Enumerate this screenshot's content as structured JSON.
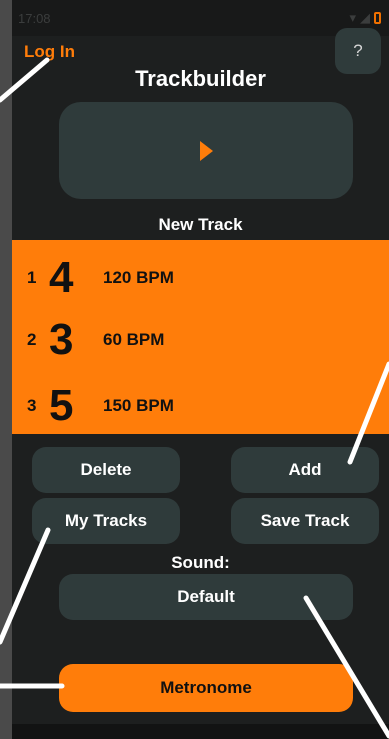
{
  "status_bar": {
    "time": "17:08",
    "icons": [
      "settings-icon",
      "wifi-icon",
      "signal-icon",
      "battery-icon"
    ]
  },
  "header": {
    "login_label": "Log In",
    "help_label": "?",
    "title": "Trackbuilder"
  },
  "player": {
    "icon": "play-icon",
    "track_name": "New Track"
  },
  "track": {
    "rows": [
      {
        "index": "1",
        "beats": "4",
        "bpm": "120 BPM"
      },
      {
        "index": "2",
        "beats": "3",
        "bpm": "60 BPM"
      },
      {
        "index": "3",
        "beats": "5",
        "bpm": "150 BPM"
      }
    ]
  },
  "actions": {
    "delete": "Delete",
    "add": "Add",
    "my_tracks": "My Tracks",
    "save_track": "Save Track"
  },
  "sound": {
    "label": "Sound:",
    "value": "Default"
  },
  "metronome": {
    "label": "Metronome"
  },
  "colors": {
    "accent": "#ff7d0a",
    "background": "#1d1f1f",
    "button": "#2f3b3b"
  }
}
